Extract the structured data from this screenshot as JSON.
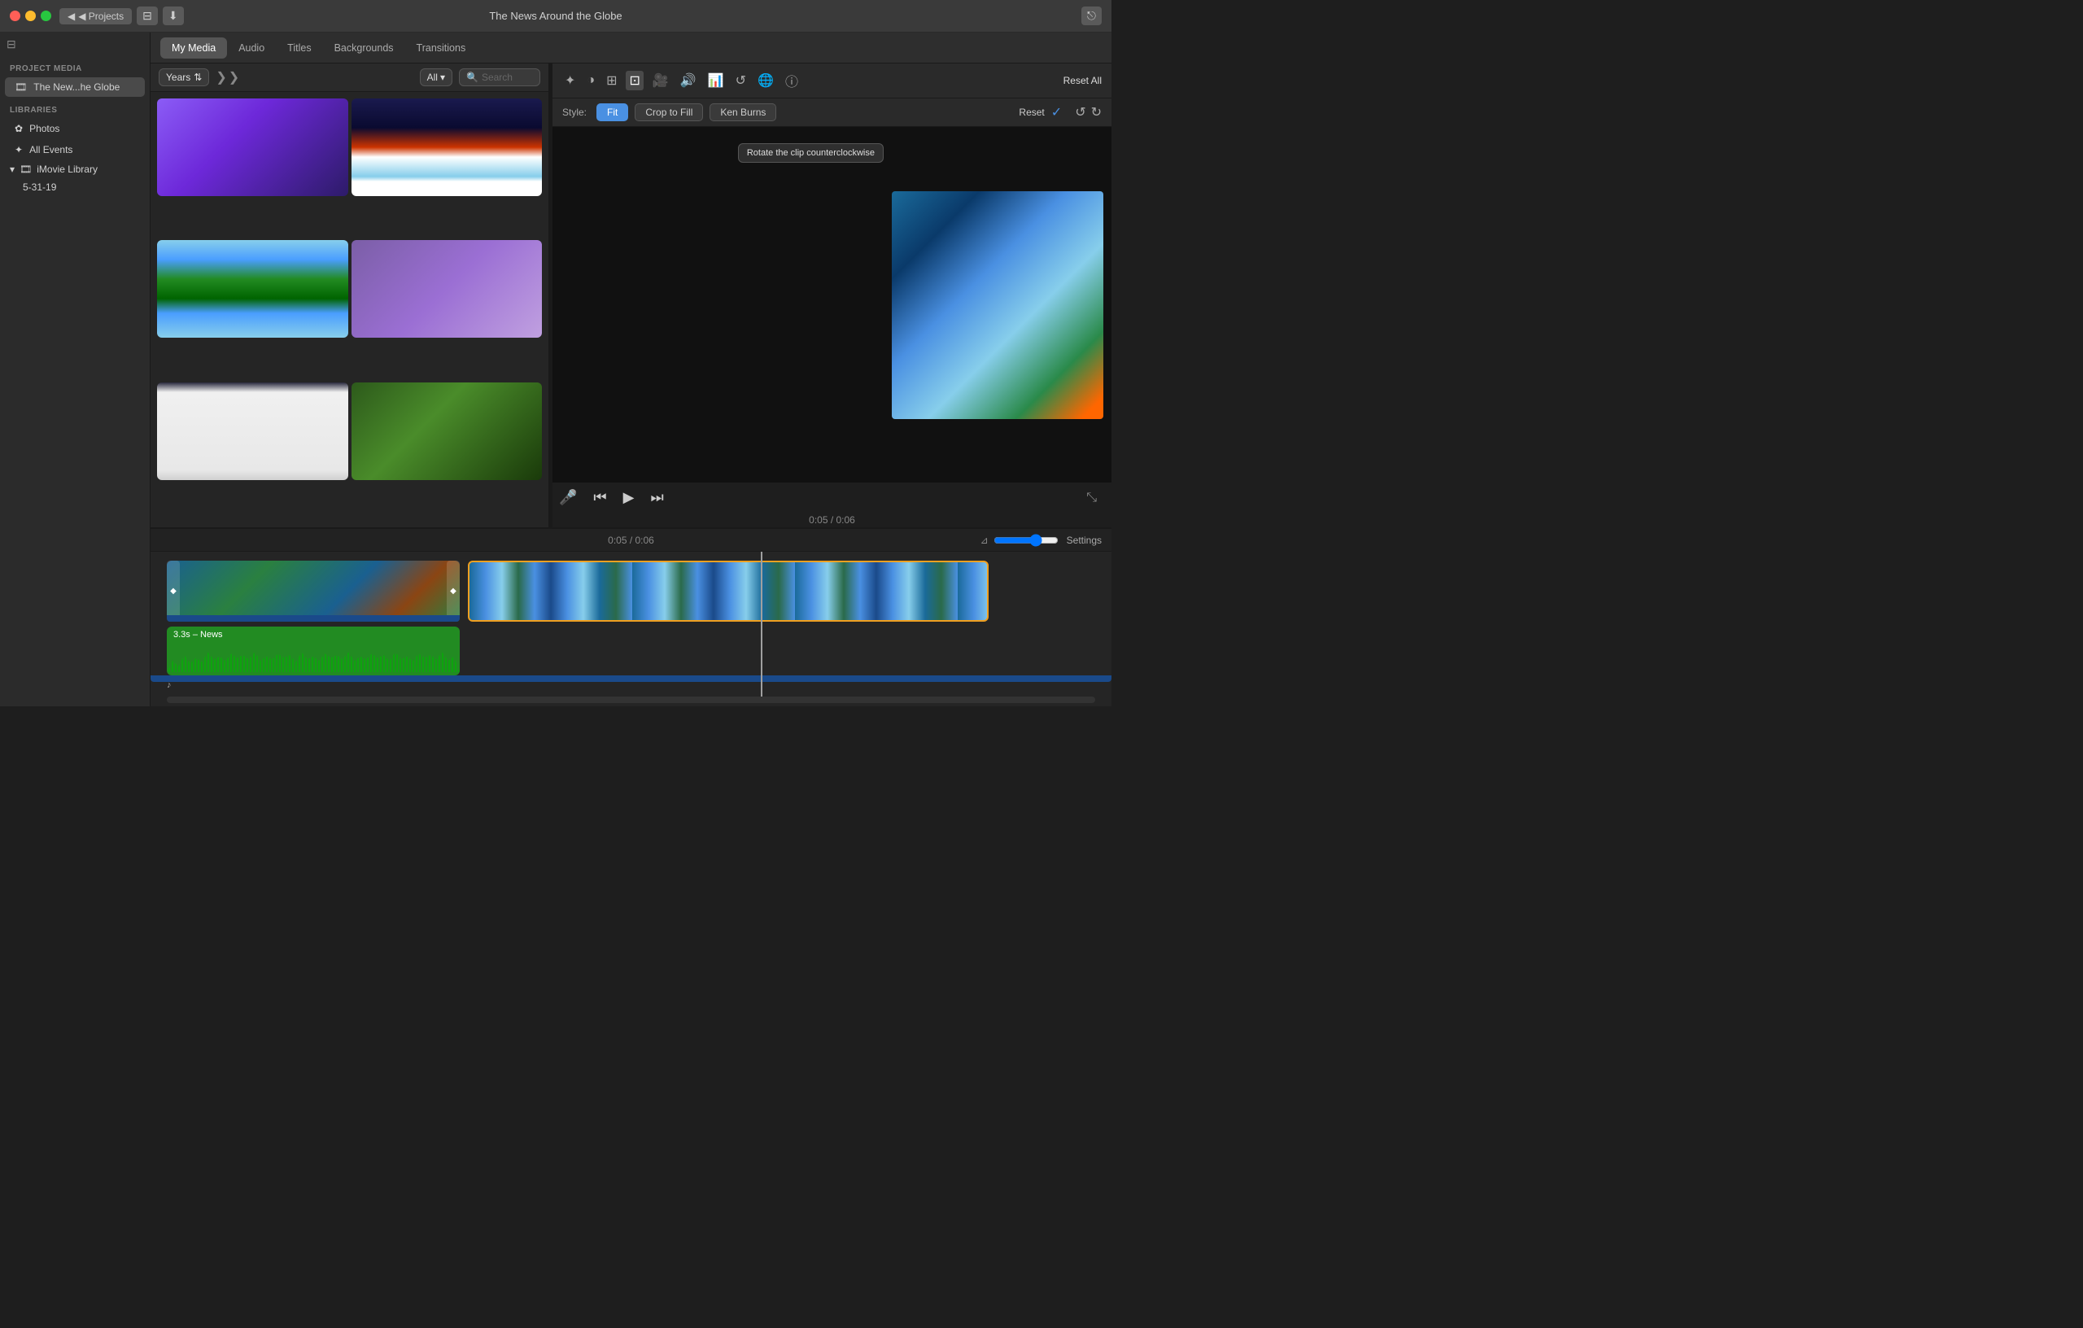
{
  "window": {
    "title": "The News Around the Globe"
  },
  "titlebar": {
    "projects_btn": "◀ Projects",
    "import_btn": "⬇",
    "share_icon": "□↗"
  },
  "nav": {
    "tabs": [
      "My Media",
      "Audio",
      "Titles",
      "Backgrounds",
      "Transitions"
    ]
  },
  "media_browser": {
    "years_label": "Years",
    "filter_label": "All",
    "search_placeholder": "Search"
  },
  "preview": {
    "style_label": "Style:",
    "style_fit": "Fit",
    "style_crop": "Crop to Fill",
    "style_ken_burns": "Ken Burns",
    "reset_btn": "Reset",
    "reset_all_btn": "Reset All",
    "tooltip": "Rotate the clip counterclockwise",
    "timecode": "0:05 / 0:06"
  },
  "timeline": {
    "timecode": "0:05 / 0:06",
    "settings_btn": "Settings",
    "audio_label": "3.3s – News"
  },
  "sidebar": {
    "project_media_label": "PROJECT MEDIA",
    "project_name": "The New...he Globe",
    "libraries_label": "LIBRARIES",
    "photos_label": "Photos",
    "all_events_label": "All Events",
    "imovie_library_label": "iMovie Library",
    "date_label": "5-31-19"
  },
  "toolbar_icons": {
    "magic_wand": "✦",
    "color_wheel": "◐",
    "filter": "⊞",
    "crop": "⊡",
    "camera": "📷",
    "volume": "🔊",
    "chart": "📊",
    "refresh": "↺",
    "globe": "🌐",
    "info": "ⓘ"
  }
}
